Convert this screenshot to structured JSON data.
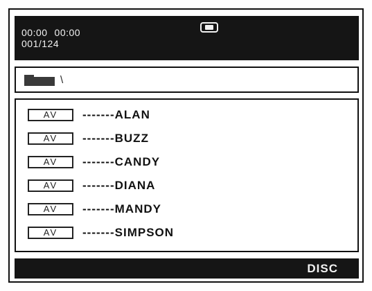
{
  "status": {
    "elapsed_time": "00:00",
    "total_time": "00:00",
    "track_counter": "001/124",
    "mode_icon": "playback-mode-icon"
  },
  "path": {
    "folder_icon": "folder-icon",
    "current_path": "\\"
  },
  "files": [
    {
      "type": "AV",
      "name": "-------ALAN"
    },
    {
      "type": "AV",
      "name": "-------BUZZ"
    },
    {
      "type": "AV",
      "name": "-------CANDY"
    },
    {
      "type": "AV",
      "name": "-------DIANA"
    },
    {
      "type": "AV",
      "name": "-------MANDY"
    },
    {
      "type": "AV",
      "name": "-------SIMPSON"
    }
  ],
  "footer": {
    "source_label": "DISC"
  },
  "colors": {
    "bar_background": "#151515",
    "bar_text": "#f2f2f2",
    "border": "#111111"
  }
}
